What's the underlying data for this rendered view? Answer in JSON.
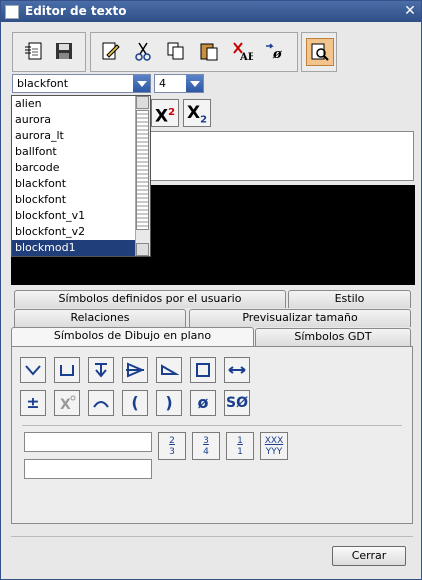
{
  "window": {
    "title": "Editor de texto",
    "close": "✕"
  },
  "font_select": {
    "value": "blackfont"
  },
  "size_select": {
    "value": "4"
  },
  "font_list": [
    "alien",
    "aurora",
    "aurora_lt",
    "ballfont",
    "barcode",
    "blackfont",
    "blockfont",
    "blockfont_v1",
    "blockfont_v2",
    "blockmod1"
  ],
  "font_list_selected": "blockmod1",
  "format_buttons": {
    "superscript_label": "X",
    "superscript_mark": "2",
    "subscript_label": "X",
    "subscript_mark": "2"
  },
  "tabs": {
    "row1": [
      "Símbolos definidos por el usuario",
      "Estilo"
    ],
    "row2": [
      "Relaciones",
      "Previsualizar tamaño"
    ],
    "row3": [
      "Símbolos de Dibujo en plano",
      "Símbolos GDT"
    ],
    "active": "Símbolos de Dibujo en plano"
  },
  "symbols_row2": {
    "plusminus": "±",
    "paren_open": "(",
    "paren_close": ")",
    "diameter": "ø",
    "sphere_diameter": "SØ"
  },
  "fractions": [
    {
      "num": "2",
      "den": "3"
    },
    {
      "num": "3",
      "den": "4"
    },
    {
      "num": "1",
      "den": "1"
    },
    {
      "num": "XXX",
      "den": "YYY"
    }
  ],
  "buttons": {
    "close_label": "Cerrar"
  }
}
